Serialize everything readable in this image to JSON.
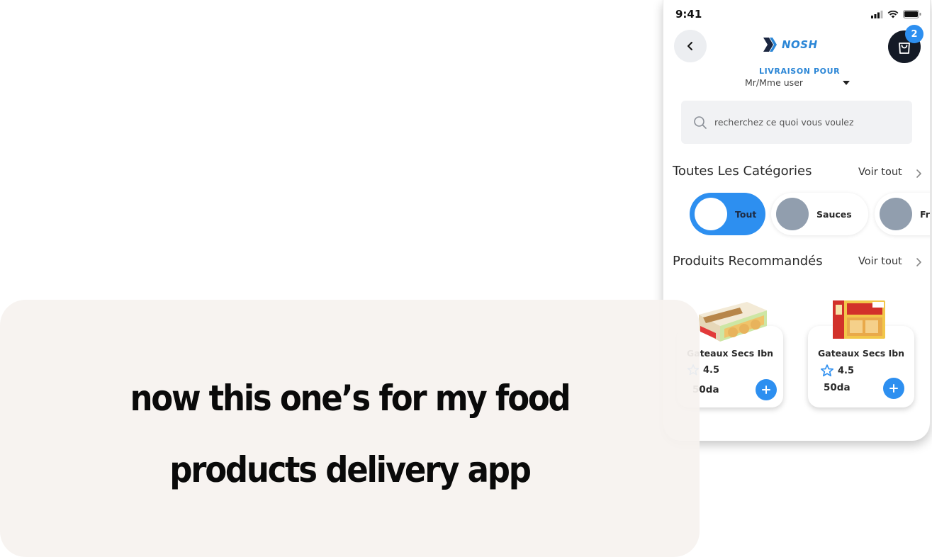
{
  "status_bar": {
    "time": "9:41"
  },
  "header": {
    "logo_text": "NOSH",
    "cart_count": "2",
    "delivery_label": "LIVRAISON POUR",
    "delivery_user": "Mr/Mme user"
  },
  "search": {
    "placeholder": "recherchez ce quoi vous voulez"
  },
  "categories": {
    "title": "Toutes Les Catégories",
    "see_all": "Voir tout",
    "items": [
      {
        "label": "Tout"
      },
      {
        "label": "Sauces"
      },
      {
        "label": "Fr"
      }
    ]
  },
  "recommended": {
    "title": "Produits Recommandés",
    "see_all": "Voir tout",
    "products": [
      {
        "name": "Gateaux Secs Ibn",
        "rating": "4.5",
        "price": "50da"
      },
      {
        "name": "Gateaux Secs Ibn",
        "rating": "4.5",
        "price": "50da"
      }
    ]
  },
  "caption": {
    "text": "now this one’s for my food products delivery app"
  },
  "colors": {
    "accent": "#2d8ff0",
    "dark": "#141a26",
    "caption_bg": "#f6f2ef"
  }
}
